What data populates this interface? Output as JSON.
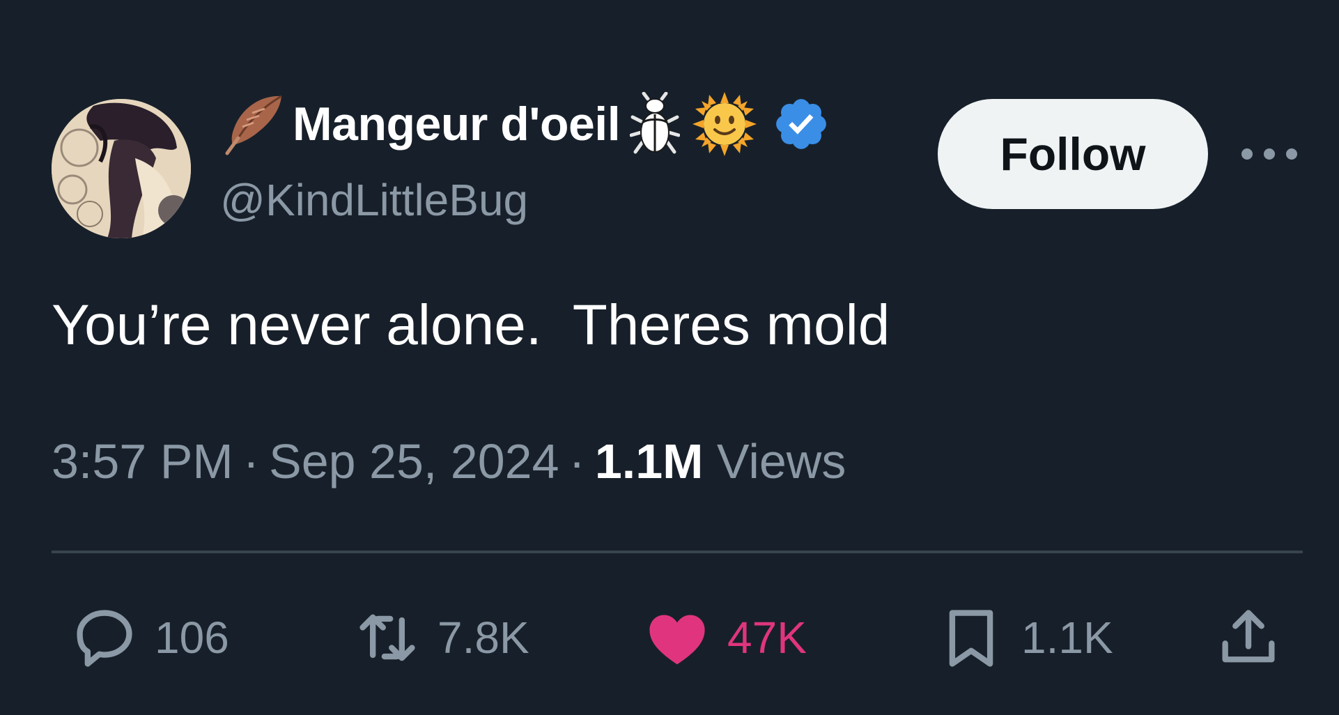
{
  "author": {
    "display_name": "Mangeur d'oeil",
    "handle": "@KindLittleBug",
    "name_emojis": [
      "feather-emoji",
      "beetle-emoji",
      "sun-with-face-emoji"
    ],
    "verified": true
  },
  "follow_button_label": "Follow",
  "tweet": {
    "text": "You’re never alone.  Theres mold"
  },
  "meta": {
    "time": "3:57 PM",
    "separator": "·",
    "date": "Sep 25, 2024",
    "views_count": "1.1M",
    "views_label": "Views"
  },
  "actions": {
    "replies": "106",
    "reposts": "7.8K",
    "likes": "47K",
    "bookmarks": "1.1K"
  },
  "colors": {
    "background": "#17202a",
    "primary_text": "#ffffff",
    "secondary_text": "#8b98a5",
    "like_pink": "#e0357e",
    "verified_blue": "#3a8ee6",
    "follow_bg": "#eff3f4",
    "divider": "#38444d"
  }
}
